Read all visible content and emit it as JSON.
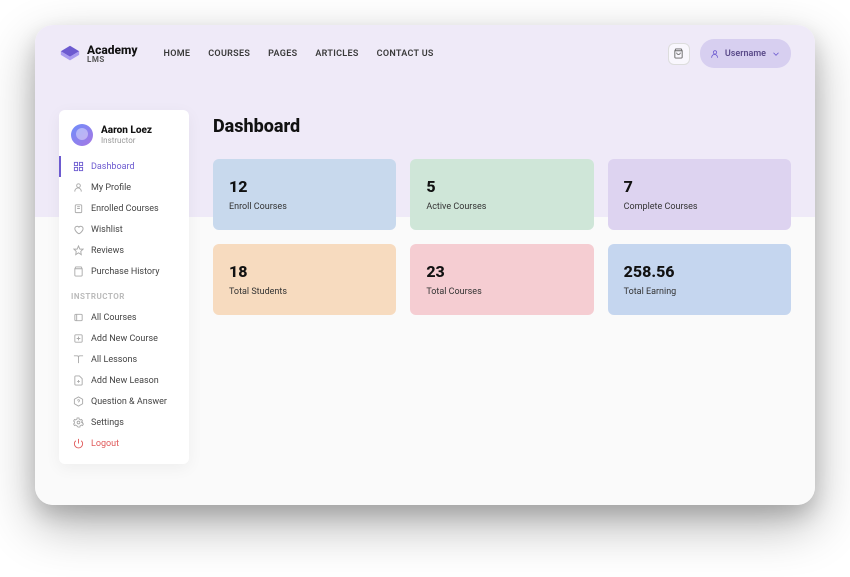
{
  "brand": {
    "title": "Academy",
    "subtitle": "LMS"
  },
  "nav": [
    "HOME",
    "COURSES",
    "PAGES",
    "ARTICLES",
    "CONTACT US"
  ],
  "user_pill": {
    "label": "Username"
  },
  "profile": {
    "name": "Aaron Loez",
    "role": "Instructor"
  },
  "menu_student": [
    {
      "key": "dashboard",
      "label": "Dashboard",
      "icon": "grid"
    },
    {
      "key": "profile",
      "label": "My Profile",
      "icon": "user"
    },
    {
      "key": "enrolled",
      "label": "Enrolled Courses",
      "icon": "book"
    },
    {
      "key": "wishlist",
      "label": "Wishlist",
      "icon": "heart"
    },
    {
      "key": "reviews",
      "label": "Reviews",
      "icon": "star"
    },
    {
      "key": "purchase",
      "label": "Purchase History",
      "icon": "bag"
    }
  ],
  "menu_instructor_label": "INSTRUCTOR",
  "menu_instructor": [
    {
      "key": "all-courses",
      "label": "All Courses",
      "icon": "layers"
    },
    {
      "key": "add-course",
      "label": "Add New Course",
      "icon": "plus-square"
    },
    {
      "key": "all-lessons",
      "label": "All Lessons",
      "icon": "book-open"
    },
    {
      "key": "add-lesson",
      "label": "Add New Leason",
      "icon": "file-plus"
    },
    {
      "key": "qa",
      "label": "Question & Answer",
      "icon": "help"
    },
    {
      "key": "settings",
      "label": "Settings",
      "icon": "gear"
    },
    {
      "key": "logout",
      "label": "Logout",
      "icon": "power"
    }
  ],
  "page": {
    "title": "Dashboard"
  },
  "stats": [
    {
      "value": "12",
      "label": "Enroll Courses",
      "color": "c-blue"
    },
    {
      "value": "5",
      "label": "Active Courses",
      "color": "c-green"
    },
    {
      "value": "7",
      "label": "Complete Courses",
      "color": "c-purple"
    },
    {
      "value": "18",
      "label": "Total Students",
      "color": "c-orange"
    },
    {
      "value": "23",
      "label": "Total Courses",
      "color": "c-pink"
    },
    {
      "value": "258.56",
      "label": "Total Earning",
      "color": "c-sky"
    }
  ]
}
